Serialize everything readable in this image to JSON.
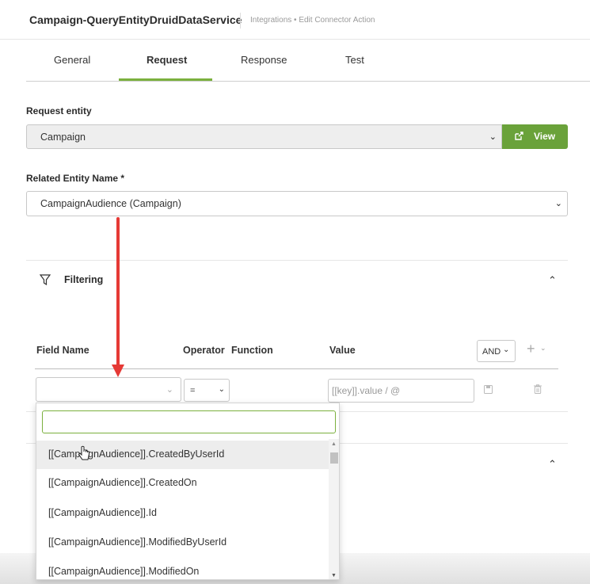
{
  "header": {
    "title": "Campaign-QueryEntityDruidDataService",
    "breadcrumb": "Integrations  •  Edit Connector Action"
  },
  "tabs": [
    {
      "label": "General",
      "active": false
    },
    {
      "label": "Request",
      "active": true
    },
    {
      "label": "Response",
      "active": false
    },
    {
      "label": "Test",
      "active": false
    }
  ],
  "request_entity": {
    "label": "Request entity",
    "value": "Campaign",
    "view_button": "View"
  },
  "related_entity": {
    "label": "Related Entity Name *",
    "value": "CampaignAudience (Campaign)"
  },
  "filtering": {
    "title": "Filtering",
    "columns": {
      "field_name": "Field Name",
      "operator": "Operator",
      "function": "Function",
      "value": "Value"
    },
    "logic": "AND",
    "row": {
      "field": "",
      "operator": "=",
      "value_placeholder": "[[key]].value / @"
    }
  },
  "dropdown": {
    "search_value": "",
    "items": [
      "[[CampaignAudience]].CreatedByUserId",
      "[[CampaignAudience]].CreatedOn",
      "[[CampaignAudience]].Id",
      "[[CampaignAudience]].ModifiedByUserId",
      "[[CampaignAudience]].ModifiedOn"
    ]
  },
  "colors": {
    "accent": "#7bb03e",
    "button": "#6aa23a",
    "annotation_arrow": "#e53935"
  }
}
